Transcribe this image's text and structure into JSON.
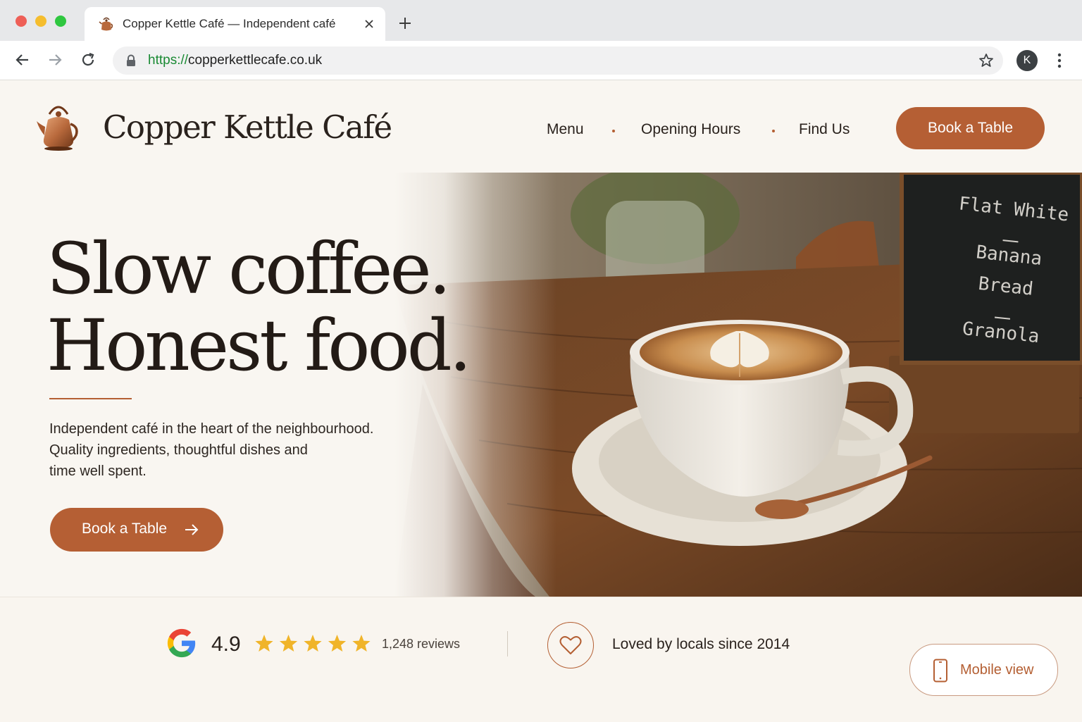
{
  "browser": {
    "tab_title": "Copper Kettle Café — Independent café",
    "url_scheme": "https://",
    "url_host": "copperkettlecafe.co.uk",
    "profile_initial": "K"
  },
  "site": {
    "brand": "Copper Kettle Café",
    "nav": [
      "Menu",
      "Opening Hours",
      "Find Us"
    ],
    "header_cta": "Book a Table",
    "colors": {
      "accent": "#b55f34",
      "background": "#f9f6f1",
      "text": "#231b16"
    }
  },
  "hero": {
    "headline_line1": "Slow coffee.",
    "headline_line2": "Honest food.",
    "lede_line1": "Independent café in the heart of the neighbourhood.",
    "lede_line2": "Quality ingredients, thoughtful dishes and",
    "lede_line3": "time well spent.",
    "cta": "Book a Table",
    "chalkboard": [
      "Flat White",
      "Banana Bread",
      "Granola"
    ]
  },
  "trust": {
    "rating": "4.9",
    "stars": 5,
    "reviews": "1,248 reviews",
    "loved": "Loved by locals since 2014",
    "mobile_view": "Mobile view"
  }
}
